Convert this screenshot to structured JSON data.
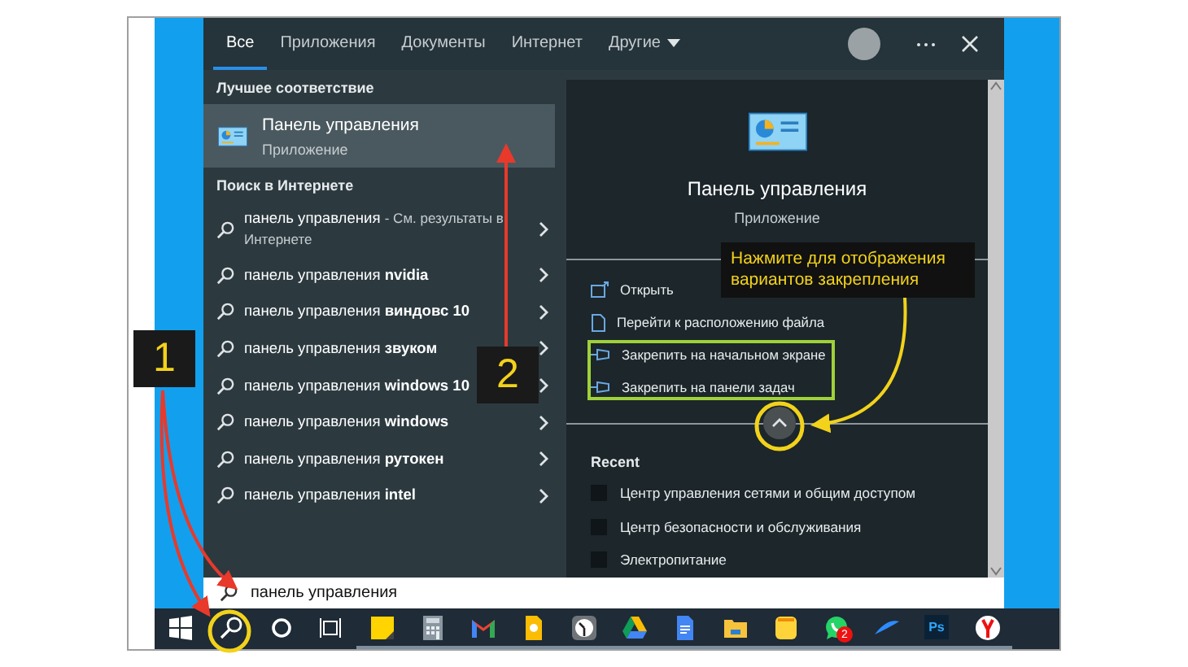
{
  "tabs": [
    {
      "label": "Все",
      "selected": true,
      "dropdown": false
    },
    {
      "label": "Приложения",
      "selected": false,
      "dropdown": false
    },
    {
      "label": "Документы",
      "selected": false,
      "dropdown": false
    },
    {
      "label": "Интернет",
      "selected": false,
      "dropdown": false
    },
    {
      "label": "Другие",
      "selected": false,
      "dropdown": true
    }
  ],
  "best_match": {
    "heading": "Лучшее соответствие",
    "title": "Панель управления",
    "subtitle": "Приложение",
    "selected": true
  },
  "web_search": {
    "heading": "Поиск в Интернете",
    "items": [
      {
        "text": "панель управления",
        "note": "- См. результаты в Интернете"
      },
      {
        "text": "панель управления **nvidia**"
      },
      {
        "text": "панель управления **виндовс 10**"
      },
      {
        "text": "панель управления **звуком**"
      },
      {
        "text": "панель управления **windows 10**"
      },
      {
        "text": "панель управления **windows**"
      },
      {
        "text": "панель управления **рутокен**"
      },
      {
        "text": "панель управления **intel**"
      }
    ]
  },
  "preview": {
    "title": "Панель управления",
    "subtitle": "Приложение",
    "actions": [
      {
        "label": "Открыть",
        "kind": "open"
      },
      {
        "label": "Перейти к расположению файла",
        "kind": "file"
      },
      {
        "label": "Закрепить на начальном экране",
        "kind": "pin"
      },
      {
        "label": "Закрепить на панели задач",
        "kind": "pin"
      }
    ],
    "recent": {
      "heading": "Recent",
      "items": [
        "Центр управления сетями и общим доступом",
        "Центр безопасности и обслуживания",
        "Электропитание"
      ]
    }
  },
  "search_box": {
    "value": "панель управления"
  },
  "taskbar": [
    {
      "kind": "windows",
      "running": false
    },
    {
      "kind": "search",
      "running": false
    },
    {
      "kind": "cortana",
      "running": false
    },
    {
      "kind": "taskview",
      "running": false
    },
    {
      "kind": "sticky",
      "running": true
    },
    {
      "kind": "calculator",
      "running": true
    },
    {
      "kind": "mail",
      "running": true
    },
    {
      "kind": "keep",
      "running": true
    },
    {
      "kind": "clock",
      "running": true
    },
    {
      "kind": "drive",
      "running": true
    },
    {
      "kind": "docs",
      "running": true
    },
    {
      "kind": "folder",
      "running": true
    },
    {
      "kind": "notes",
      "running": true
    },
    {
      "kind": "chat",
      "running": true,
      "badge": "2"
    },
    {
      "kind": "swoosh",
      "running": true
    },
    {
      "kind": "ps",
      "running": true,
      "label": "Ps"
    },
    {
      "kind": "browser",
      "running": true
    }
  ],
  "annotations": {
    "markers": [
      "1",
      "2"
    ],
    "callout": "Нажмите для отображения вариантов закрепления"
  }
}
